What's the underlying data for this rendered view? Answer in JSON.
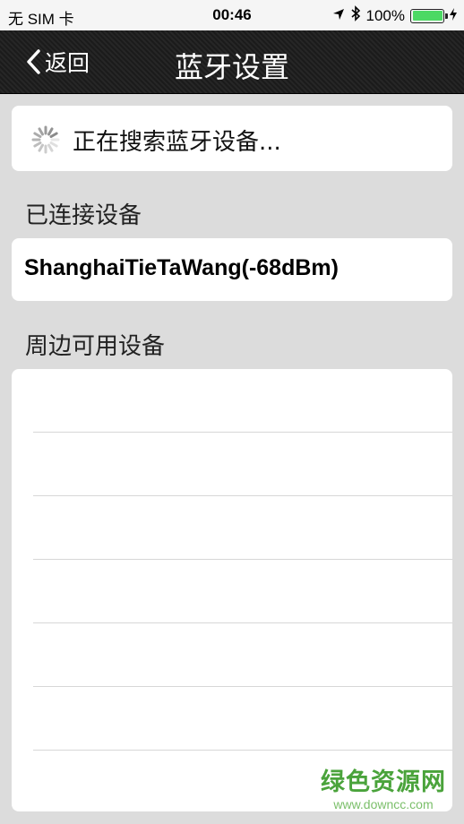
{
  "status_bar": {
    "carrier": "无 SIM 卡",
    "time": "00:46",
    "battery": "100%",
    "battery_level": 1.0
  },
  "nav": {
    "back_label": "返回",
    "title": "蓝牙设置"
  },
  "search": {
    "text": "正在搜索蓝牙设备..."
  },
  "connected": {
    "header": "已连接设备",
    "devices": [
      "ShanghaiTieTaWang(-68dBm)"
    ]
  },
  "nearby": {
    "header": "周边可用设备",
    "rows": [
      "",
      "",
      "",
      "",
      "",
      "",
      ""
    ]
  },
  "watermark": {
    "title": "绿色资源网",
    "url": "www.downcc.com"
  },
  "colors": {
    "accent": "#4cd964",
    "navbar": "#222222",
    "background": "#dcdcdc"
  }
}
